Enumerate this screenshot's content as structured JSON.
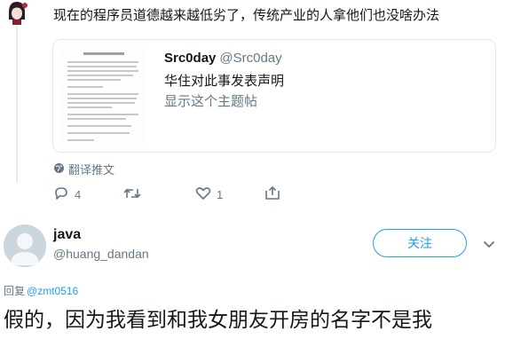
{
  "top_tweet": {
    "text": "现在的程序员道德越来越低劣了，传统产业的人拿他们也没啥办法",
    "quote": {
      "name": "Src0day",
      "handle": "@Src0day",
      "text": "华住对此事发表声明",
      "thread_link": "显示这个主题帖",
      "thumbnail_icon": "document-thumbnail-icon"
    },
    "translate_label": "翻译推文",
    "actions": {
      "reply_count": "4",
      "retweet_count": "",
      "like_count": "1"
    }
  },
  "reply": {
    "user": {
      "name": "java",
      "handle": "@huang_dandan"
    },
    "follow_label": "关注",
    "replying_to_label": "回复",
    "replying_to_mention": "@zmt0516",
    "text": "假的，因为我看到和我女朋友开房的名字不是我"
  },
  "colors": {
    "accent": "#1da1f2",
    "muted": "#657786",
    "text": "#14171a",
    "border": "#e1e8ed"
  }
}
